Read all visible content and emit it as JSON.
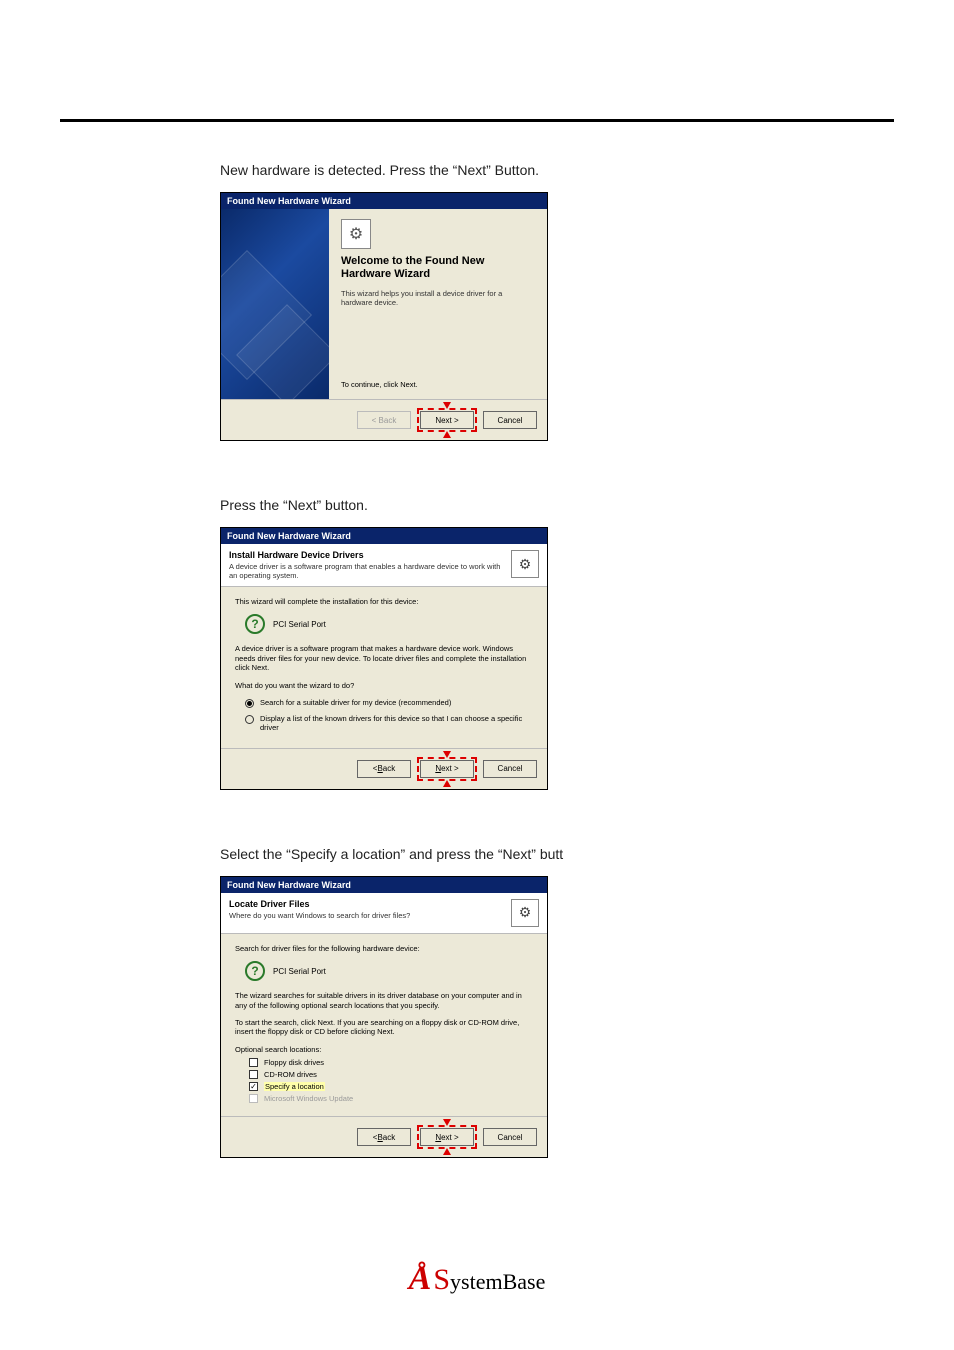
{
  "captions": {
    "c1": "New hardware is detected. Press the “Next” Button.",
    "c2": "Press the “Next” button.",
    "c3": "Select the “Specify a location” and press the “Next” butt"
  },
  "dialog1": {
    "title": "Found New Hardware Wizard",
    "welcome": "Welcome to the Found New Hardware Wizard",
    "desc": "This wizard helps you install a device driver for a hardware device.",
    "continue": "To continue, click Next."
  },
  "dialog2": {
    "title": "Found New Hardware Wizard",
    "heading": "Install Hardware Device Drivers",
    "sub": "A device driver is a software program that enables a hardware device to work with an operating system.",
    "line1": "This wizard will complete the installation for this device:",
    "device": "PCI Serial Port",
    "para": "A device driver is a software program that makes a hardware device work. Windows needs driver files for your new device. To locate driver files and complete the installation click Next.",
    "q": "What do you want the wizard to do?",
    "opt1": "Search for a suitable driver for my device (recommended)",
    "opt2": "Display a list of the known drivers for this device so that I can choose a specific driver"
  },
  "dialog3": {
    "title": "Found New Hardware Wizard",
    "heading": "Locate Driver Files",
    "sub": "Where do you want Windows to search for driver files?",
    "line1": "Search for driver files for the following hardware device:",
    "device": "PCI Serial Port",
    "para1": "The wizard searches for suitable drivers in its driver database on your computer and in any of the following optional search locations that you specify.",
    "para2": "To start the search, click Next. If you are searching on a floppy disk or CD-ROM drive, insert the floppy disk or CD before clicking Next.",
    "optlabel": "Optional search locations:",
    "opt_floppy": "Floppy disk drives",
    "opt_cdrom": "CD-ROM drives",
    "opt_specify": "Specify a location",
    "opt_wu": "Microsoft Windows Update"
  },
  "buttons": {
    "back": "< Back",
    "next": "Next >",
    "next_underline_prefix": "N",
    "next_underline_rest": "ext >",
    "cancel": "Cancel"
  },
  "footer": {
    "glyph": "Å",
    "s": "S",
    "rest": "ystemBase"
  }
}
